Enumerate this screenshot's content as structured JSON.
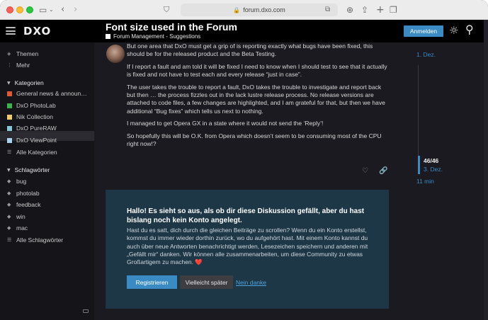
{
  "browser": {
    "url": "forum.dxo.com",
    "icons": [
      "sidebar-toggle-icon",
      "back-icon",
      "forward-icon",
      "shield-icon",
      "translate-icon",
      "download-icon",
      "share-icon",
      "new-tab-icon",
      "tabs-overview-icon"
    ]
  },
  "header": {
    "logo": "DXO",
    "title": "Font size used in the Forum",
    "category": "Forum Management - Suggestions",
    "login_button": "Anmelden"
  },
  "sidebar": {
    "top": [
      {
        "label": "Themen",
        "icon": "layers-icon"
      },
      {
        "label": "Mehr",
        "icon": "more-icon"
      }
    ],
    "categories_header": "Kategorien",
    "categories": [
      {
        "label": "General news & announ…",
        "color": "#e45735"
      },
      {
        "label": "DxO PhotoLab",
        "color": "#3ab54a"
      },
      {
        "label": "Nik Collection",
        "color": "#f0cc6c"
      },
      {
        "label": "DxO PureRAW",
        "color": "#83c7d8"
      },
      {
        "label": "DxO ViewPoint",
        "color": "#a9d2f2"
      },
      {
        "label": "Alle Kategorien",
        "color": ""
      }
    ],
    "tags_header": "Schlagwörter",
    "tags": [
      {
        "label": "bug"
      },
      {
        "label": "photolab"
      },
      {
        "label": "feedback"
      },
      {
        "label": "win"
      },
      {
        "label": "mac"
      },
      {
        "label": "Alle Schlagwörter"
      }
    ]
  },
  "post": {
    "paragraphs": [
      "But one area that DxO must get a grip of is reporting exactly what bugs have been fixed, this should be for the released product and the Beta Testing.",
      "If I report a fault and am told it will be fixed I need to know when I should test to see that it actually is fixed and not have to test each and every release “just in case”.",
      "The user takes the trouble to report a fault, DxO takes the trouble to investigate and report back but then … the process fizzles out in the lack lustre release process. No release versions are attached to code files, a few changes are highlighted, and I am grateful for that, but then we have additional “Bug fixes” which tells us next to nothing.",
      "I managed to get Opera GX in a state where it would not send the ‘Reply’!",
      "So hopefully this will be O.K. from Opera which doesn’t seem to be consuming most of the CPU right now!?"
    ]
  },
  "timeline": {
    "start": "1. Dez.",
    "position": "46/46",
    "current_date": "3. Dez.",
    "ago": "11 min"
  },
  "cta": {
    "heading": "Hallo! Es sieht so aus, als ob dir diese Diskussion gefällt, aber du hast bislang noch kein Konto angelegt.",
    "body": "Hast du es satt, dich durch die gleichen Beiträge zu scrollen? Wenn du ein Konto erstellst, kommst du immer wieder dorthin zurück, wo du aufgehört hast. Mit einem Konto kannst du auch über neue Antworten benachrichtigt werden, Lesezeichen speichern und anderen mit „Gefällt mir“ danken. Wir können alle zusammenarbeiten, um diese Community zu etwas Großartigem zu machen. ❤️",
    "register": "Registrieren",
    "later": "Vielleicht später",
    "no_thanks": "Nein danke"
  },
  "colors": {
    "accent": "#3a8ac4",
    "background": "#1b1a20",
    "cta_background": "#1d3747"
  }
}
